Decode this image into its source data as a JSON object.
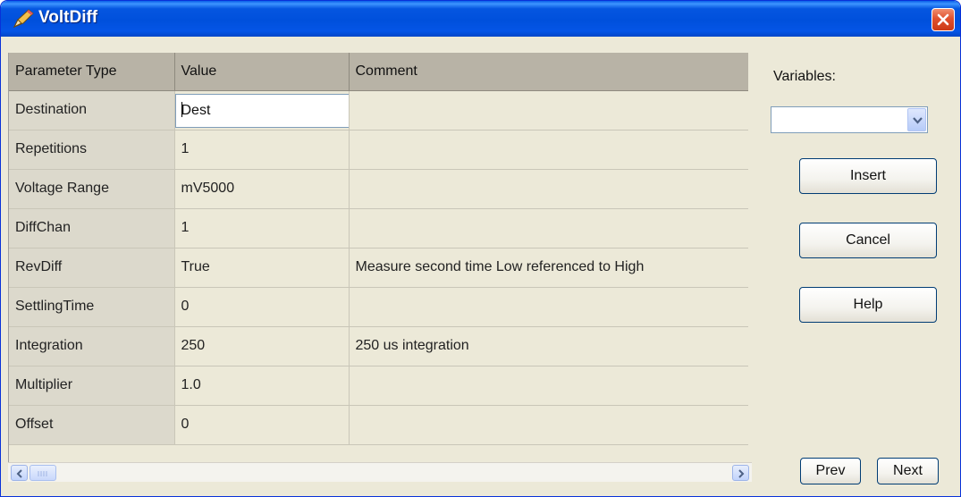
{
  "window": {
    "title": "VoltDiff"
  },
  "grid": {
    "headers": [
      "Parameter Type",
      "Value",
      "Comment"
    ],
    "rows": [
      {
        "param": "Destination",
        "value": "Dest",
        "comment": ""
      },
      {
        "param": "Repetitions",
        "value": "1",
        "comment": ""
      },
      {
        "param": "Voltage Range",
        "value": "mV5000",
        "comment": ""
      },
      {
        "param": "DiffChan",
        "value": "1",
        "comment": ""
      },
      {
        "param": "RevDiff",
        "value": "True",
        "comment": "Measure second time Low referenced to High"
      },
      {
        "param": "SettlingTime",
        "value": "0",
        "comment": ""
      },
      {
        "param": "Integration",
        "value": "250",
        "comment": "250 us integration"
      },
      {
        "param": "Multiplier",
        "value": "1.0",
        "comment": ""
      },
      {
        "param": "Offset",
        "value": "0",
        "comment": ""
      }
    ]
  },
  "side": {
    "variables_label": "Variables:",
    "variables_selected": "",
    "insert_label": "Insert",
    "cancel_label": "Cancel",
    "help_label": "Help",
    "prev_label": "Prev",
    "next_label": "Next"
  },
  "icons": {
    "app": "pen-icon",
    "close": "close-icon",
    "combo": "chevron-down-icon",
    "scroll_left": "arrow-left-icon",
    "scroll_right": "arrow-right-icon"
  },
  "colors": {
    "titlebar": "#0054e3",
    "close_button": "#e0512e",
    "dialog_face": "#ece9d8",
    "header_fill": "#b8b3a6",
    "param_column_fill": "#dcd9cc"
  }
}
